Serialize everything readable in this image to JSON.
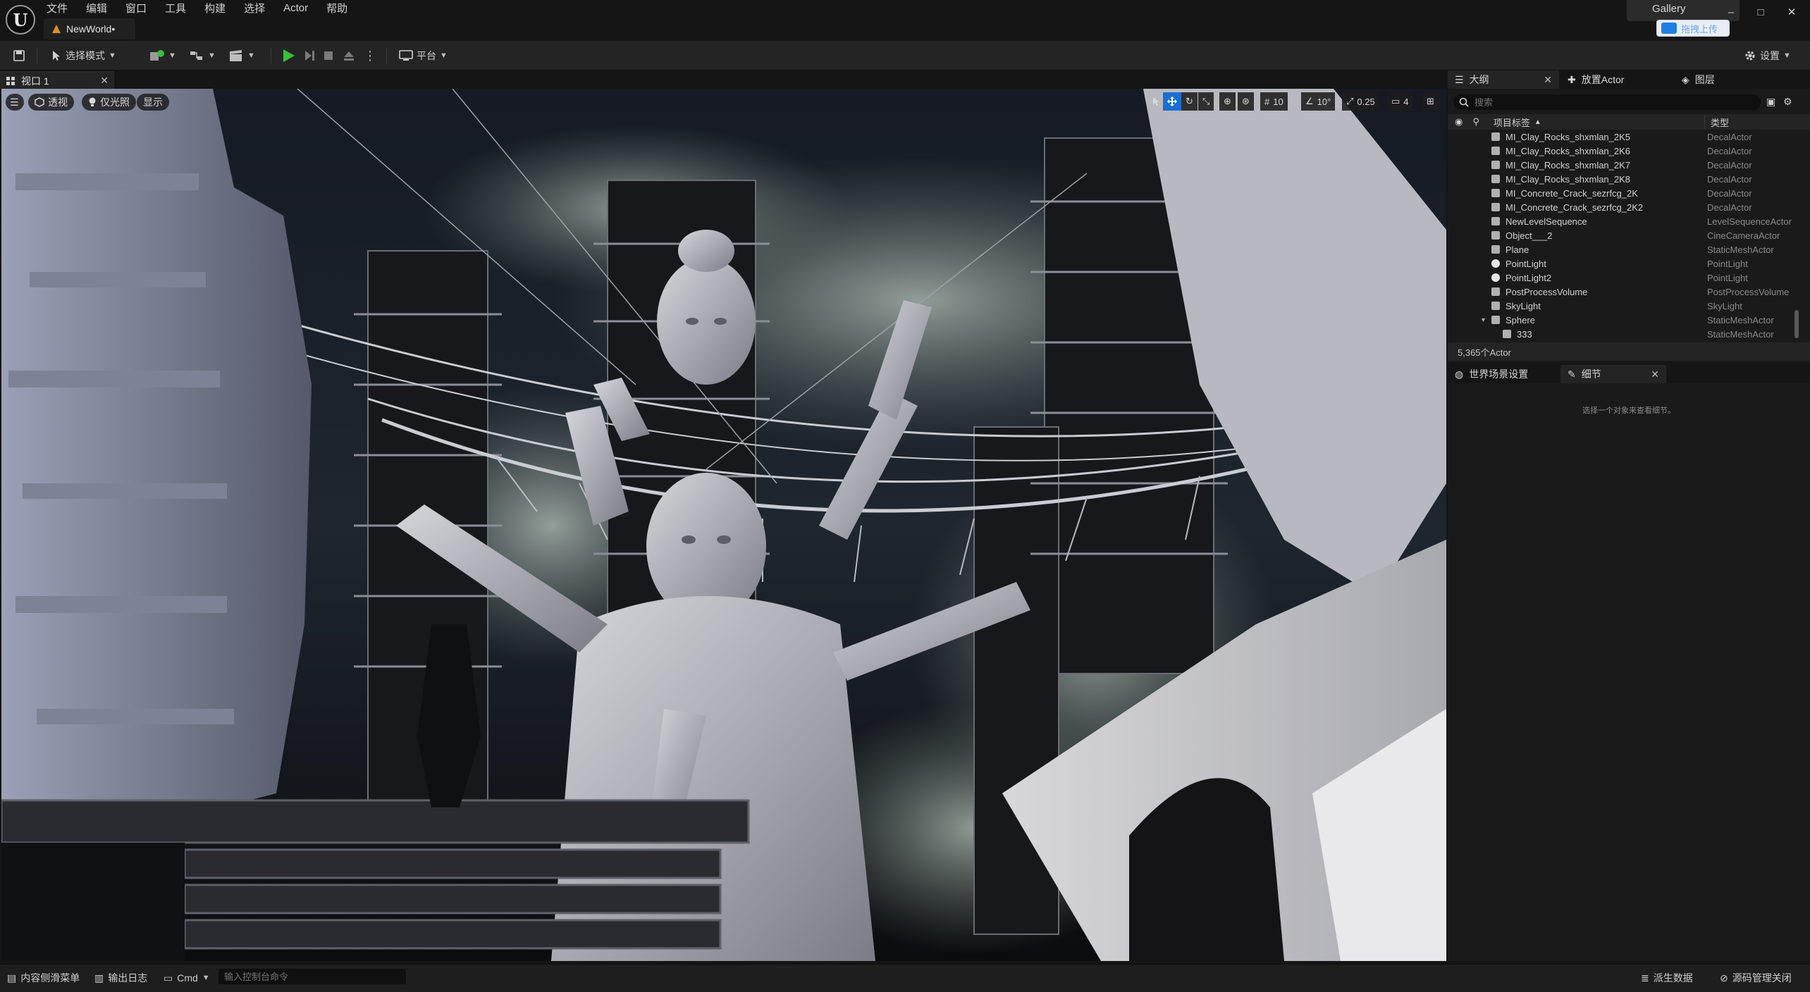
{
  "app": {
    "menu": [
      "文件",
      "编辑",
      "窗口",
      "工具",
      "构建",
      "选择",
      "Actor",
      "帮助"
    ],
    "document_tab": "NewWorld•",
    "gallery_label": "Gallery",
    "upload_label": "拖拽上传",
    "window_controls": [
      "–",
      "□",
      "✕"
    ]
  },
  "toolbar": {
    "mode_label": "选择模式",
    "platform_label": "平台",
    "settings_label": "设置"
  },
  "viewport": {
    "tab_label": "视口 1",
    "view_type": "透视",
    "lighting_mode": "仅光照",
    "show_label": "显示",
    "grid_snap": "10",
    "rotation_snap": "10°",
    "scale_snap": "0.25",
    "camera_speed": "4"
  },
  "outliner": {
    "tabs": [
      "大纲",
      "放置Actor",
      "图层"
    ],
    "search_placeholder": "搜索",
    "col_label": "项目标签",
    "col_type": "类型",
    "rows": [
      {
        "name": "MI_Clay_Rocks_shxmlan_2K5",
        "type": "DecalActor",
        "icon": "decal",
        "indent": 1
      },
      {
        "name": "MI_Clay_Rocks_shxmlan_2K6",
        "type": "DecalActor",
        "icon": "decal",
        "indent": 1
      },
      {
        "name": "MI_Clay_Rocks_shxmlan_2K7",
        "type": "DecalActor",
        "icon": "decal",
        "indent": 1
      },
      {
        "name": "MI_Clay_Rocks_shxmlan_2K8",
        "type": "DecalActor",
        "icon": "decal",
        "indent": 1
      },
      {
        "name": "MI_Concrete_Crack_sezrfcg_2K",
        "type": "DecalActor",
        "icon": "decal",
        "indent": 1
      },
      {
        "name": "MI_Concrete_Crack_sezrfcg_2K2",
        "type": "DecalActor",
        "icon": "decal",
        "indent": 1
      },
      {
        "name": "NewLevelSequence",
        "type": "LevelSequenceActor",
        "icon": "sequence",
        "indent": 1
      },
      {
        "name": "Object___2",
        "type": "CineCameraActor",
        "icon": "camera",
        "indent": 1
      },
      {
        "name": "Plane",
        "type": "StaticMeshActor",
        "icon": "mesh",
        "indent": 1
      },
      {
        "name": "PointLight",
        "type": "PointLight",
        "icon": "light",
        "indent": 1
      },
      {
        "name": "PointLight2",
        "type": "PointLight",
        "icon": "light",
        "indent": 1
      },
      {
        "name": "PostProcessVolume",
        "type": "PostProcessVolume",
        "icon": "volume",
        "indent": 1
      },
      {
        "name": "SkyLight",
        "type": "SkyLight",
        "icon": "sky",
        "indent": 1
      },
      {
        "name": "Sphere",
        "type": "StaticMeshActor",
        "icon": "mesh",
        "indent": 1,
        "expanded": true
      },
      {
        "name": "333",
        "type": "StaticMeshActor",
        "icon": "mesh",
        "indent": 2
      }
    ],
    "actor_count": "5,365个Actor"
  },
  "details": {
    "tabs": [
      "世界场景设置",
      "细节"
    ],
    "empty_message": "选择一个对象来查看细节。"
  },
  "statusbar": {
    "content_drawer": "内容侧滑菜单",
    "output_log": "输出日志",
    "cmd_label": "Cmd",
    "console_placeholder": "输入控制台命令",
    "derived_data": "派生数据",
    "source_control": "源码管理关闭"
  },
  "colors": {
    "accent": "#1a6fd0",
    "play": "#3cbd3c",
    "panel": "#1a1a1a",
    "toolbar": "#242424"
  }
}
